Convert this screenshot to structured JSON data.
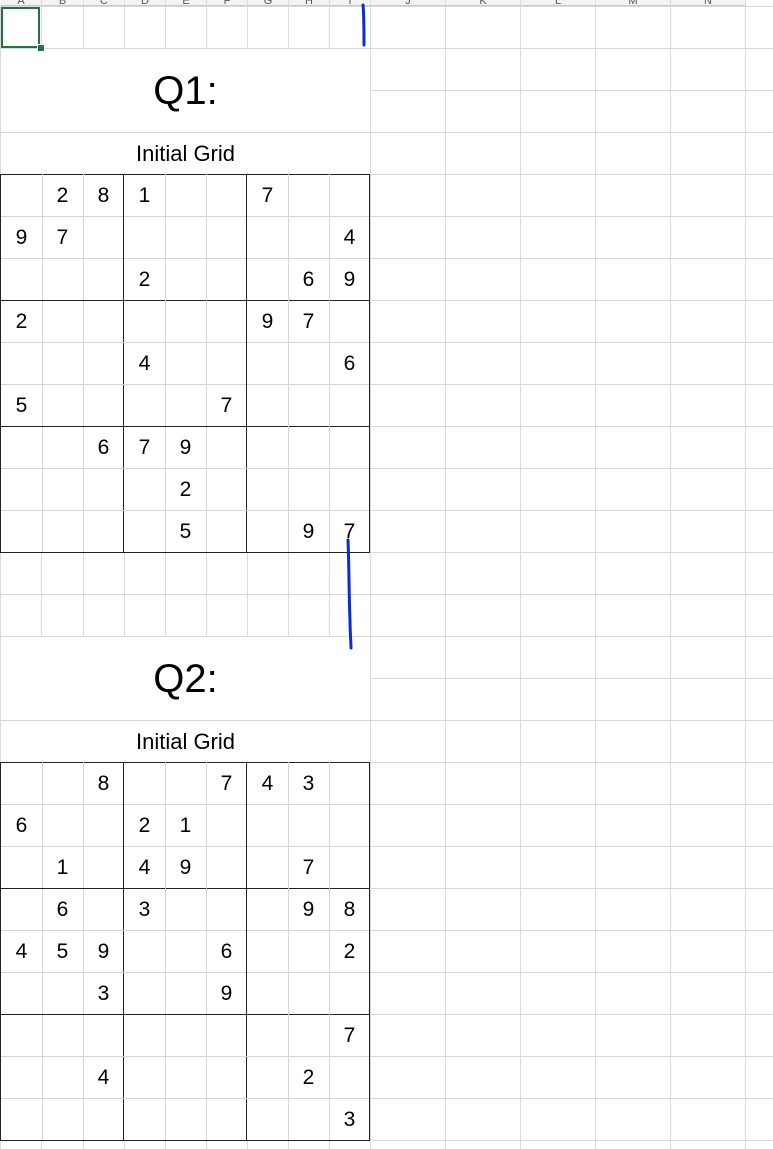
{
  "column_headers": [
    "A",
    "B",
    "C",
    "D",
    "E",
    "F",
    "G",
    "H",
    "I",
    "J",
    "K",
    "L",
    "M",
    "N"
  ],
  "active_cell": "A1",
  "ink_color": "#0a2bd6",
  "puzzles": [
    {
      "title": "Q1:",
      "subtitle": "Initial Grid",
      "grid": [
        [
          "",
          "2",
          "8",
          "1",
          "",
          "",
          "7",
          "",
          ""
        ],
        [
          "9",
          "7",
          "",
          "",
          "",
          "",
          "",
          "",
          "4"
        ],
        [
          "",
          "",
          "",
          "2",
          "",
          "",
          "",
          "6",
          "9"
        ],
        [
          "2",
          "",
          "",
          "",
          "",
          "",
          "9",
          "7",
          ""
        ],
        [
          "",
          "",
          "",
          "4",
          "",
          "",
          "",
          "",
          "6"
        ],
        [
          "5",
          "",
          "",
          "",
          "",
          "7",
          "",
          "",
          ""
        ],
        [
          "",
          "",
          "6",
          "7",
          "9",
          "",
          "",
          "",
          ""
        ],
        [
          "",
          "",
          "",
          "",
          "2",
          "",
          "",
          "",
          ""
        ],
        [
          "",
          "",
          "",
          "",
          "5",
          "",
          "",
          "9",
          "7"
        ]
      ]
    },
    {
      "title": "Q2:",
      "subtitle": "Initial Grid",
      "grid": [
        [
          "",
          "",
          "8",
          "",
          "",
          "7",
          "4",
          "3",
          ""
        ],
        [
          "6",
          "",
          "",
          "2",
          "1",
          "",
          "",
          "",
          ""
        ],
        [
          "",
          "1",
          "",
          "4",
          "9",
          "",
          "",
          "7",
          ""
        ],
        [
          "",
          "6",
          "",
          "3",
          "",
          "",
          "",
          "9",
          "8"
        ],
        [
          "4",
          "5",
          "9",
          "",
          "",
          "6",
          "",
          "",
          "2"
        ],
        [
          "",
          "",
          "3",
          "",
          "",
          "9",
          "",
          "",
          ""
        ],
        [
          "",
          "",
          "",
          "",
          "",
          "",
          "",
          "",
          "7"
        ],
        [
          "",
          "",
          "4",
          "",
          "",
          "",
          "",
          "2",
          ""
        ],
        [
          "",
          "",
          "",
          "",
          "",
          "",
          "",
          "",
          "3"
        ]
      ]
    }
  ]
}
